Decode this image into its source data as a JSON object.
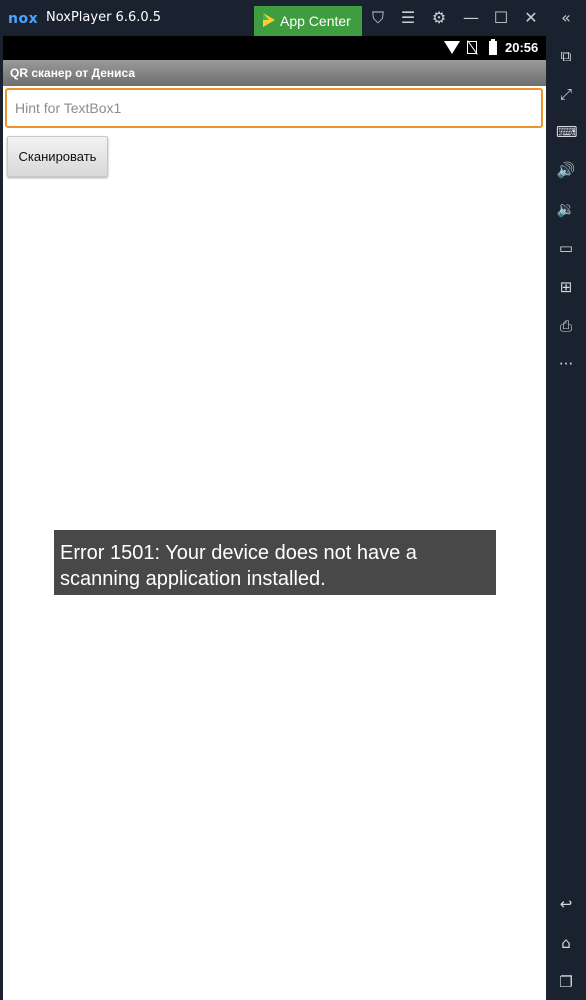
{
  "window": {
    "logo": "nox",
    "title": "NoxPlayer 6.6.0.5",
    "app_center_label": "App Center",
    "title_icons": [
      "shirt-icon",
      "menu-icon",
      "gear-icon",
      "minimize-icon",
      "maximize-icon",
      "close-icon",
      "collapse-icon"
    ]
  },
  "statusbar": {
    "time": "20:56",
    "icons": [
      "wifi-icon",
      "no-sim-icon",
      "battery-icon"
    ]
  },
  "app": {
    "title": "QR сканер от Дениса",
    "textbox": {
      "placeholder": "Hint for TextBox1",
      "value": ""
    },
    "scan_button_label": "Сканировать",
    "toast": "Error 1501: Your device does not have a scanning application installed."
  },
  "sidebar": {
    "tools": [
      "multi-instance-icon",
      "fullscreen-icon",
      "keyboard-icon",
      "volume-up-icon",
      "volume-down-icon",
      "screen-icon",
      "apk-install-icon",
      "bulk-icon",
      "more-icon"
    ],
    "nav": [
      "back-icon",
      "home-icon",
      "recents-icon"
    ]
  },
  "colors": {
    "chrome_bg": "#1a2230",
    "app_center_bg": "#3e9d3e",
    "textbox_border": "#f0922a",
    "toast_bg": "#484848"
  }
}
